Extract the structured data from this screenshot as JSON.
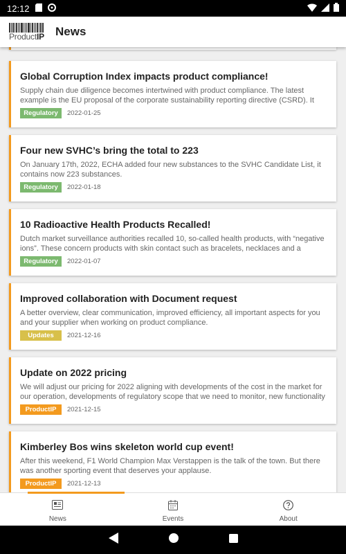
{
  "status_bar": {
    "time": "12:12"
  },
  "app_bar": {
    "logo_text_a": "Product",
    "logo_text_b": "IP",
    "title": "News"
  },
  "colors": {
    "accent": "#f39a1e",
    "regulatory": "#7cb96f",
    "updates": "#d8c04a",
    "productip": "#f39a1e"
  },
  "news": [
    {
      "title": "Global Corruption Index impacts product compliance!",
      "text": "Supply chain due diligence becomes intertwined with product compliance. The latest example is the EU proposal of the corporate sustainability reporting directive (CSRD). It will",
      "tag": "Regulatory",
      "date": "2022-01-25"
    },
    {
      "title": "Four new SVHC’s bring the total to 223",
      "text": "On January 17th, 2022, ECHA added four new substances to the SVHC Candidate List, it contains now 223 substances.",
      "tag": "Regulatory",
      "date": "2022-01-18"
    },
    {
      "title": "10 Radioactive Health Products Recalled!",
      "text": "Dutch market surveillance authorities recalled 10, so-called health products, with “negative ions”. These concern products with skin contact such as bracelets, necklaces and a sleeping",
      "tag": "Regulatory",
      "date": "2022-01-07"
    },
    {
      "title": "Improved collaboration with Document request",
      "text": "A better overview, clear communication, improved efficiency, all important aspects for you and your supplier when working on product compliance.",
      "tag": "Updates",
      "date": "2021-12-16"
    },
    {
      "title": "Update on 2022 pricing",
      "text": "We will adjust our pricing for 2022 aligning with developments of the cost in the market for our operation, developments of regulatory scope that we need to monitor, new functionality of",
      "tag": "ProductIP",
      "date": "2021-12-15"
    },
    {
      "title": "Kimberley Bos wins skeleton world cup event!",
      "text": "After this weekend, F1 World Champion Max Verstappen is the talk of the town. But there was another sporting event that deserves your applause.",
      "tag": "ProductIP",
      "date": "2021-12-13"
    }
  ],
  "bottom_nav": {
    "items": [
      {
        "label": "News",
        "icon": "newspaper-icon",
        "active": true
      },
      {
        "label": "Events",
        "icon": "calendar-icon",
        "active": false
      },
      {
        "label": "About",
        "icon": "help-circle-icon",
        "active": false
      }
    ]
  },
  "system_nav": {
    "icons": [
      "back-icon",
      "home-icon",
      "recents-icon"
    ]
  }
}
